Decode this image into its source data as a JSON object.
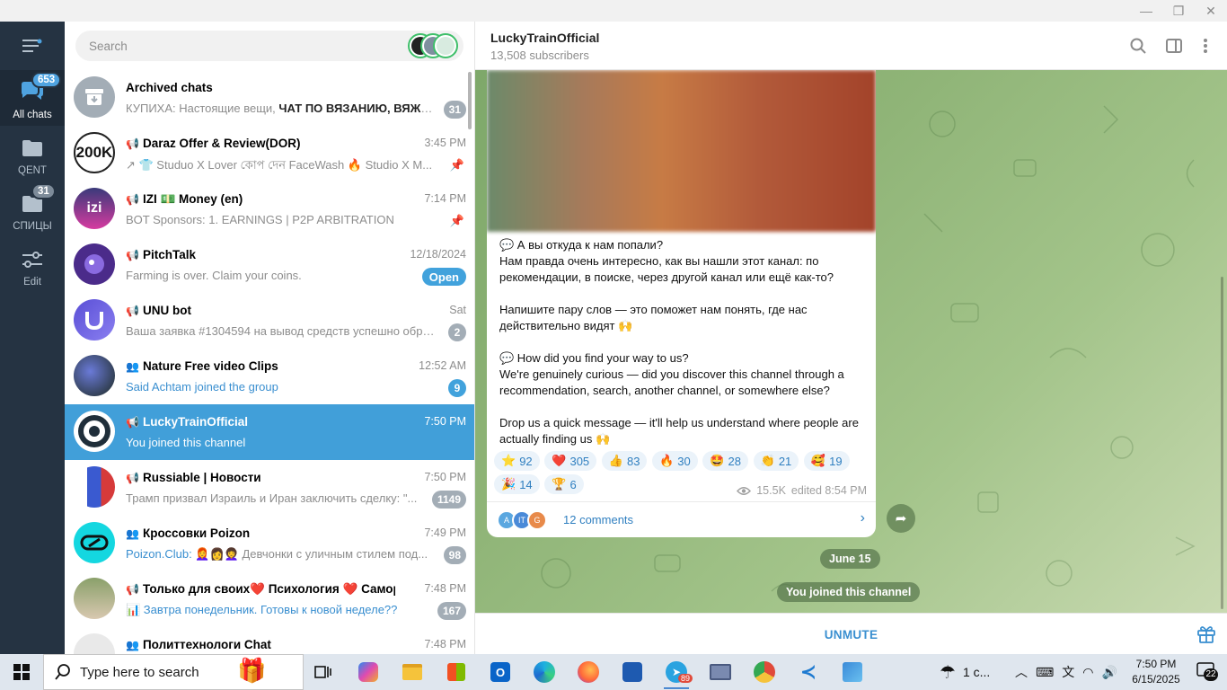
{
  "window": {
    "title": "Telegram"
  },
  "rail": {
    "items": [
      {
        "label": "All chats",
        "badge": "653"
      },
      {
        "label": "QENT",
        "badge": ""
      },
      {
        "label": "СПИЦЫ",
        "badge": "31"
      },
      {
        "label": "Edit",
        "badge": ""
      }
    ]
  },
  "search": {
    "placeholder": "Search"
  },
  "chats": [
    {
      "title": "Archived chats",
      "time": "",
      "preview_a": "КУПИХА: Настоящие вещи, ",
      "preview_b": "ЧАТ ПО ВЯЗАНИЮ, ВЯЖЕ...",
      "badge": "31"
    },
    {
      "title": "Daraz Offer & Review(DOR)",
      "time": "3:45 PM",
      "preview": "↗ 👕 Studuo X Lover কোপ দেন FaceWash 🔥 Studio X M...",
      "badge": "",
      "avatar_text": "200K"
    },
    {
      "title": "IZI 💵 Money (en)",
      "time": "7:14 PM",
      "preview": "BOT Sponsors:  1. EARNINGS | P2P ARBITRATION",
      "badge": "",
      "avatar_text": "izi"
    },
    {
      "title": "PitchTalk",
      "time": "12/18/2024",
      "preview": "Farming is over. Claim your coins.",
      "badge": "Open"
    },
    {
      "title": "UNU bot",
      "time": "Sat",
      "preview": "Ваша заявка #1304594 на вывод средств успешно обра...",
      "badge": "2"
    },
    {
      "title": "Nature Free video Clips",
      "time": "12:52 AM",
      "preview": "Said Achtam joined the group",
      "badge": "9"
    },
    {
      "title": "LuckyTrainOfficial",
      "time": "7:50 PM",
      "preview": "You joined this channel",
      "badge": ""
    },
    {
      "title": "Russiable | Новости",
      "time": "7:50 PM",
      "preview": "Трамп призвал Израиль и Иран заключить сделку: \"...",
      "badge": "1149"
    },
    {
      "title": "Кроссовки Poizon",
      "time": "7:49 PM",
      "preview_a": "Poizon.Club: ",
      "preview_b": "👩‍🦰👩👩‍🦱 Девчонки с уличным стилем под...",
      "badge": "98"
    },
    {
      "title": "Только для своих❤️ Психология ❤️ Самораз...",
      "time": "7:48 PM",
      "preview": "📊 Завтра понедельник. Готовы к новой неделе??",
      "badge": "167"
    },
    {
      "title": "Политтехнологи Chat",
      "time": "7:48 PM",
      "preview": "",
      "badge": ""
    }
  ],
  "channel": {
    "title": "LuckyTrainOfficial",
    "subtitle": "13,508 subscribers"
  },
  "message": {
    "text": "💬 А вы откуда к нам попали?\nНам правда очень интересно, как вы нашли этот канал: по рекомендации, в поиске, через другой канал или ещё как-то?\n\nНапишите пару слов — это поможет нам понять, где нас действительно видят 🙌\n\n💬 How did you find your way to us?\nWe're genuinely curious — did you discover this channel through a recommendation, search, another channel, or somewhere else?\n\nDrop us a quick message — it'll help us understand where people are actually finding us 🙌",
    "reactions": [
      {
        "emoji": "⭐",
        "count": "92"
      },
      {
        "emoji": "❤️",
        "count": "305"
      },
      {
        "emoji": "👍",
        "count": "83"
      },
      {
        "emoji": "🔥",
        "count": "30"
      },
      {
        "emoji": "🤩",
        "count": "28"
      },
      {
        "emoji": "👏",
        "count": "21"
      },
      {
        "emoji": "🥰",
        "count": "19"
      },
      {
        "emoji": "🎉",
        "count": "14"
      },
      {
        "emoji": "🏆",
        "count": "6"
      }
    ],
    "views": "15.5K",
    "edited": "edited 8:54 PM",
    "comments": "12 comments",
    "comment_avatars": [
      "A",
      "IT",
      "G"
    ]
  },
  "service": {
    "date": "June 15",
    "joined": "You joined this channel"
  },
  "composer": {
    "unmute": "UNMUTE"
  },
  "taskbar": {
    "search": "Type here to search",
    "telegram_badge": "89",
    "weather": "1 c...",
    "time": "7:50 PM",
    "date": "6/15/2025",
    "notifications": "22"
  },
  "colors": {
    "accent": "#419fd9",
    "rail": "#253342",
    "link": "#3a8fd0"
  }
}
